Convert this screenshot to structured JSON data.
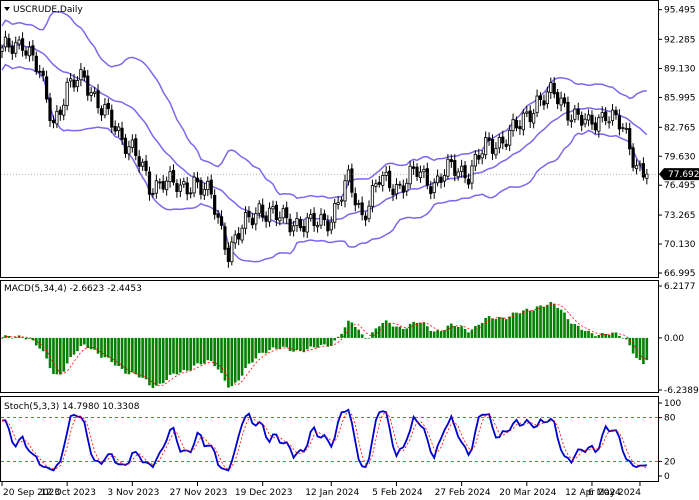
{
  "window": {
    "symbol_label": "USCRUDE,Daily",
    "dropdown_icon": "triangle-down-icon"
  },
  "colors": {
    "background": "#ffffff",
    "candle": "#000000",
    "bands": "#7b68ee",
    "macd_bar": "#008000",
    "macd_signal": "#ff0000",
    "stoch_main": "#0000cd",
    "stoch_signal": "#ff0000",
    "level_line": "#ff0000",
    "price_tag_bg": "#000000",
    "price_tag_text": "#ffffff"
  },
  "price_panel": {
    "ylim": [
      66.995,
      96.0
    ],
    "ticks": [
      "95.495",
      "92.285",
      "89.130",
      "85.995",
      "82.765",
      "79.630",
      "76.495",
      "73.265",
      "70.130",
      "66.995"
    ],
    "current_price": "77.692"
  },
  "macd_panel": {
    "label": "MACD(5,34,4) -2.6623 -2.4453",
    "ylim": [
      -6.2389,
      6.2177
    ],
    "ticks": [
      "6.2177",
      "0.00",
      "-6.2389"
    ]
  },
  "stoch_panel": {
    "label": "Stoch(5,3,3) 14.7980 10.3308",
    "ylim": [
      0,
      100
    ],
    "ticks": [
      "100",
      "80",
      "20",
      "0"
    ],
    "levels": [
      80,
      20
    ]
  },
  "x_axis": {
    "labels": [
      "20 Sep 2023",
      "12 Oct 2023",
      "3 Nov 2023",
      "27 Nov 2023",
      "19 Dec 2023",
      "12 Jan 2024",
      "5 Feb 2024",
      "27 Feb 2024",
      "20 Mar 2024",
      "12 Apr 2024",
      "6 May 2024"
    ]
  },
  "chart_data": {
    "type": "candlestick",
    "title": "USCRUDE,Daily",
    "x_labels": [
      "20 Sep 2023",
      "12 Oct 2023",
      "3 Nov 2023",
      "27 Nov 2023",
      "19 Dec 2023",
      "12 Jan 2024",
      "5 Feb 2024",
      "27 Feb 2024",
      "20 Mar 2024",
      "12 Apr 2024",
      "6 May 2024"
    ],
    "close_anchors": [
      [
        0,
        90.8
      ],
      [
        6,
        92.3
      ],
      [
        11,
        88.3
      ],
      [
        15,
        83.5
      ],
      [
        19,
        86.6
      ],
      [
        24,
        88.5
      ],
      [
        29,
        84.5
      ],
      [
        34,
        82.3
      ],
      [
        38,
        80.5
      ],
      [
        43,
        76.2
      ],
      [
        47,
        77.3
      ],
      [
        52,
        75.8
      ],
      [
        56,
        77.2
      ],
      [
        61,
        75.0
      ],
      [
        66,
        69.5
      ],
      [
        70,
        71.6
      ],
      [
        75,
        74.2
      ],
      [
        80,
        72.9
      ],
      [
        85,
        72.7
      ],
      [
        90,
        72.0
      ],
      [
        96,
        73.2
      ],
      [
        101,
        76.8
      ],
      [
        105,
        73.4
      ],
      [
        110,
        76.9
      ],
      [
        116,
        76.5
      ],
      [
        121,
        77.8
      ],
      [
        126,
        76.8
      ],
      [
        131,
        78.2
      ],
      [
        136,
        78.0
      ],
      [
        141,
        80.4
      ],
      [
        146,
        81.6
      ],
      [
        151,
        82.8
      ],
      [
        156,
        85.8
      ],
      [
        161,
        86.2
      ],
      [
        166,
        84.5
      ],
      [
        171,
        82.7
      ],
      [
        176,
        84.6
      ],
      [
        181,
        82.4
      ],
      [
        185,
        78.9
      ],
      [
        188,
        77.7
      ]
    ],
    "bollinger_period": 20,
    "bollinger_deviation": 2,
    "macd": {
      "fast": 5,
      "slow": 34,
      "signal": 4,
      "last_main": -2.6623,
      "last_signal": -2.4453
    },
    "stochastic": {
      "k": 5,
      "d": 3,
      "slowing": 3,
      "last_main": 14.798,
      "last_signal": 10.3308
    }
  }
}
